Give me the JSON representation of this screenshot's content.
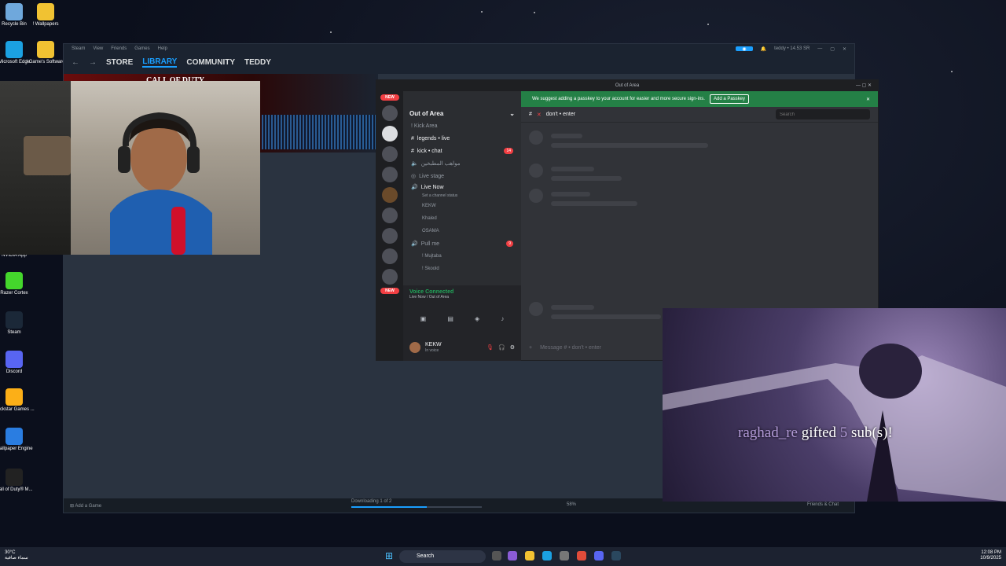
{
  "desktop": {
    "icons": [
      {
        "label": "Recycle Bin",
        "color": "#6fa8dc"
      },
      {
        "label": "! Wallpapers",
        "color": "#f1c232"
      },
      {
        "label": "Microsoft Edge",
        "color": "#1ba1e2"
      },
      {
        "label": "! Game's Software",
        "color": "#f1c232"
      },
      {
        "label": "NVIDIA App",
        "color": "#76b900"
      },
      {
        "label": "Razer Cortex",
        "color": "#44d62c"
      },
      {
        "label": "Steam",
        "color": "#1b2838"
      },
      {
        "label": "Discord",
        "color": "#5865f2"
      },
      {
        "label": "Rockstar Games ...",
        "color": "#fcaf17"
      },
      {
        "label": "Wallpaper Engine",
        "color": "#2a7de1"
      },
      {
        "label": "Call of Duty® M...",
        "color": "#222222"
      }
    ]
  },
  "steam": {
    "menu": [
      "Steam",
      "View",
      "Friends",
      "Games",
      "Help"
    ],
    "nav": {
      "store": "STORE",
      "library": "LIBRARY",
      "community": "COMMUNITY",
      "user": "TEDDY"
    },
    "account": "teddy • 14.53 SR",
    "banner_text": "CALL OF DUTY",
    "add_game": "Add a Game",
    "downloading": "Downloading 1 of 2",
    "download_percent": "58%",
    "download_progress": 0.58,
    "friends_chat": "Friends & Chat"
  },
  "discord": {
    "window_title": "Out of Area",
    "banner": {
      "text": "We suggest adding a passkey to your account for easier and more secure sign-ins.",
      "button": "Add a Passkey"
    },
    "server_name": "Out of Area",
    "badge_new": "NEW",
    "channels": [
      {
        "name": "! Kick Area",
        "type": "category"
      },
      {
        "name": "legends • live",
        "type": "text"
      },
      {
        "name": "kick • chat",
        "type": "text",
        "badge": "14"
      },
      {
        "name": "مواهب المطبخين",
        "type": "voice"
      },
      {
        "name": "Live stage",
        "type": "stage"
      },
      {
        "name": "Live Now",
        "type": "voice"
      }
    ],
    "channel_status": "Set a channel status",
    "voice_members": [
      "KEKW",
      "Khaled",
      "OSAMA"
    ],
    "pull_me": {
      "name": "Pull me",
      "badge": "9",
      "members": [
        "! Mujtaba",
        "! Skoold"
      ]
    },
    "voice_connected": "Voice Connected",
    "voice_location": "Live Now / Out of Area",
    "user": {
      "name": "KEKW",
      "status": "In voice"
    },
    "chat_channel": "don't • enter",
    "search_placeholder": "Search",
    "message_placeholder": "Message # • don't • enter"
  },
  "overlay": {
    "gift_user": "raghad_re",
    "gift_text": " gifted ",
    "gift_count": "5",
    "gift_suffix": " sub(s)!"
  },
  "taskbar": {
    "weather_temp": "30°C",
    "weather_desc": "سماء صافية",
    "search": "Search",
    "time": "12:08 PM",
    "date": "10/9/2025"
  }
}
